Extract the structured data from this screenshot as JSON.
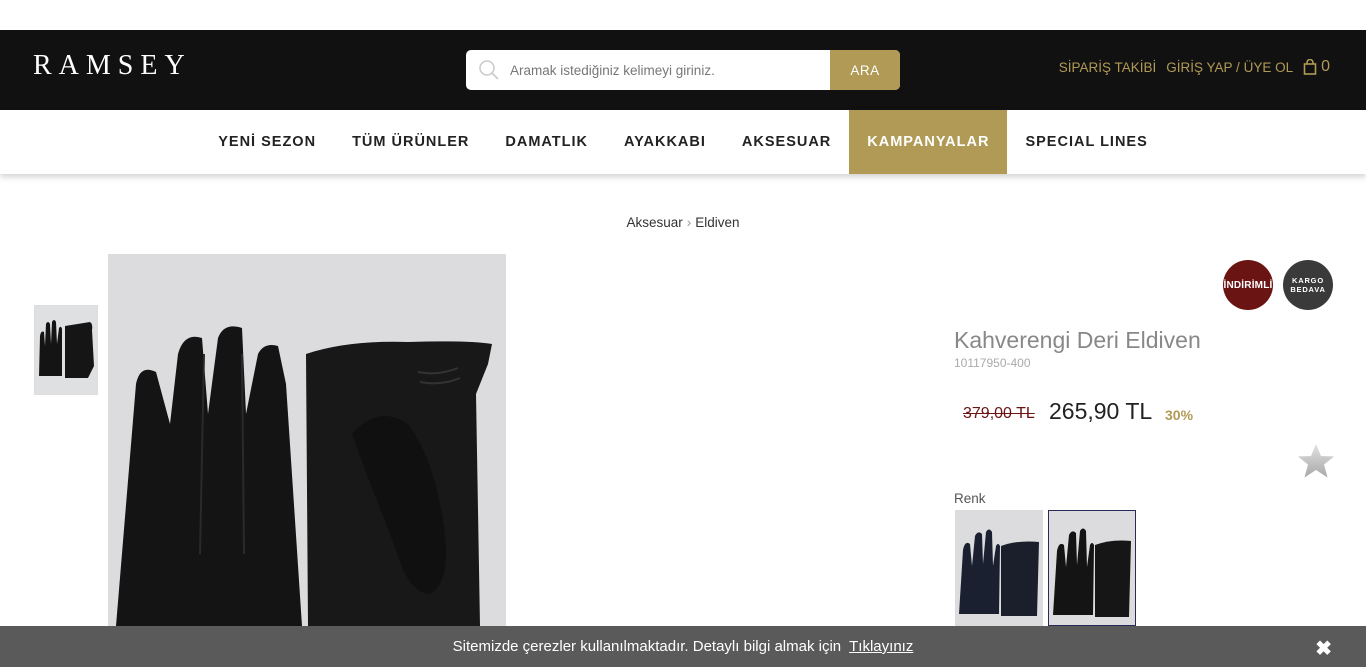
{
  "header": {
    "logo": "RAMSEY",
    "search_placeholder": "Aramak istediğiniz kelimeyi giriniz.",
    "search_button": "ARA",
    "order_tracking": "SİPARİŞ TAKİBİ",
    "login": "GİRİŞ YAP / ÜYE OL",
    "cart_count": "0"
  },
  "nav": {
    "items": [
      {
        "label": "YENİ SEZON"
      },
      {
        "label": "TÜM ÜRÜNLER"
      },
      {
        "label": "DAMATLIK"
      },
      {
        "label": "AYAKKABI"
      },
      {
        "label": "AKSESUAR"
      },
      {
        "label": "KAMPANYALAR",
        "active": true
      },
      {
        "label": "SPECIAL LINES"
      }
    ]
  },
  "breadcrumb": {
    "items": [
      "Aksesuar",
      "Eldiven"
    ]
  },
  "product": {
    "badge_discount": "İNDİRİMLİ",
    "badge_shipping_line1": "KARGO",
    "badge_shipping_line2": "BEDAVA",
    "title": "Kahverengi Deri Eldiven",
    "code": "10117950-400",
    "old_price": "379,00 TL",
    "new_price": "265,90 TL",
    "discount_percent": "30%",
    "color_label": "Renk"
  },
  "cookie": {
    "text": "Sitemizde çerezler kullanılmaktadır. Detaylı bilgi almak için",
    "link": "Tıklayınız",
    "close_symbol": "✖"
  },
  "colors": {
    "header_bg": "#111111",
    "accent_gold": "#b09a55",
    "discount_badge": "#6b1414",
    "cookie_bg": "#5a5a5a"
  }
}
